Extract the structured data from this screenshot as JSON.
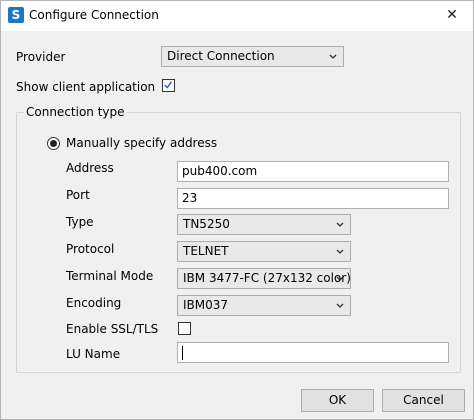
{
  "window": {
    "title": "Configure Connection",
    "app_icon_glyph": "S",
    "close_glyph": "✕"
  },
  "provider": {
    "label": "Provider",
    "value": "Direct Connection"
  },
  "show_client": {
    "label": "Show client application",
    "checked": true
  },
  "connection_type": {
    "group_label": "Connection type",
    "manual_label": "Manually specify address",
    "fields": {
      "address": {
        "label": "Address",
        "value": "pub400.com"
      },
      "port": {
        "label": "Port",
        "value": "23"
      },
      "type": {
        "label": "Type",
        "value": "TN5250"
      },
      "protocol": {
        "label": "Protocol",
        "value": "TELNET"
      },
      "terminal_mode": {
        "label": "Terminal Mode",
        "value": "IBM 3477-FC (27x132 color)"
      },
      "encoding": {
        "label": "Encoding",
        "value": "IBM037"
      },
      "ssl": {
        "label": "Enable SSL/TLS",
        "checked": false
      },
      "lu_name": {
        "label": "LU Name",
        "value": ""
      }
    }
  },
  "buttons": {
    "ok": "OK",
    "cancel": "Cancel"
  },
  "colors": {
    "accent": "#1f74c4",
    "check": "#1f5fb4"
  }
}
